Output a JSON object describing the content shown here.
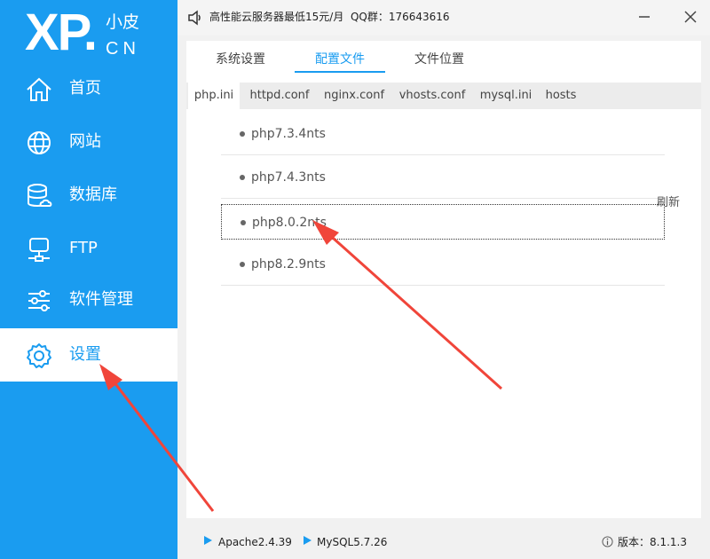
{
  "logo": {
    "main": "XP.",
    "small": "小皮",
    "cn": "CN"
  },
  "sidebar": {
    "items": [
      {
        "label": "首页",
        "icon": "home-icon"
      },
      {
        "label": "网站",
        "icon": "globe-icon"
      },
      {
        "label": "数据库",
        "icon": "database-icon"
      },
      {
        "label": "FTP",
        "icon": "ftp-server-icon"
      },
      {
        "label": "软件管理",
        "icon": "sliders-icon"
      },
      {
        "label": "设置",
        "icon": "gear-icon",
        "active": true
      }
    ]
  },
  "titlebar": {
    "notice": "高性能云服务器最低15元/月  QQ群：176643616",
    "minimize_icon": "minimize-icon",
    "close_icon": "close-icon"
  },
  "top_tabs": [
    {
      "label": "系统设置"
    },
    {
      "label": "配置文件",
      "active": true
    },
    {
      "label": "文件位置"
    }
  ],
  "sub_tabs": [
    {
      "label": "php.ini",
      "active": true
    },
    {
      "label": "httpd.conf"
    },
    {
      "label": "nginx.conf"
    },
    {
      "label": "vhosts.conf"
    },
    {
      "label": "mysql.ini"
    },
    {
      "label": "hosts"
    }
  ],
  "versions": [
    {
      "label": "php7.3.4nts"
    },
    {
      "label": "php7.4.3nts"
    },
    {
      "label": "php8.0.2nts",
      "selected": true
    },
    {
      "label": "php8.2.9nts"
    }
  ],
  "refresh_label": "刷新",
  "status": {
    "apache": "Apache2.4.39",
    "mysql": "MySQL5.7.26",
    "version": "版本：8.1.1.3"
  },
  "colors": {
    "accent": "#1a9cf0",
    "annotation_arrow": "#f0453a"
  }
}
